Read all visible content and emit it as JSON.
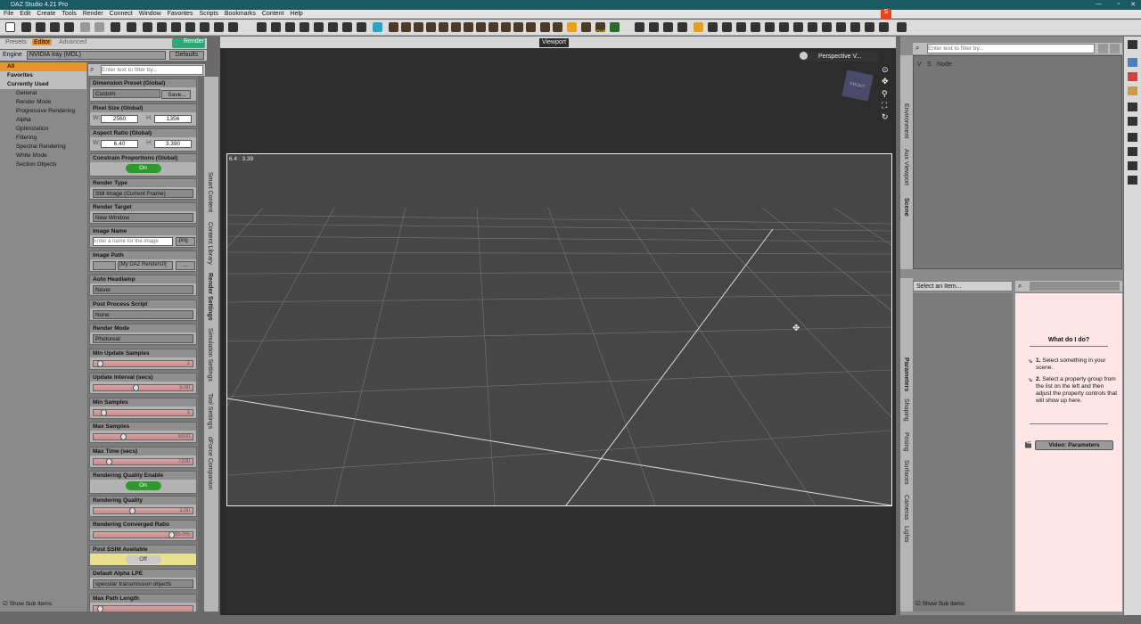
{
  "window": {
    "title": "DAZ Studio 4.21 Pro"
  },
  "menu": [
    "File",
    "Edit",
    "Create",
    "Tools",
    "Render",
    "Connect",
    "Window",
    "Favorites",
    "Scripts",
    "Bookmarks",
    "Content",
    "Help"
  ],
  "tabs": {
    "presets": "Presets",
    "editor": "Editor",
    "advanced": "Advanced",
    "render_btn": "Render"
  },
  "engine": {
    "label": "Engine",
    "value": "NVIDIA Iray (MDL)",
    "defaults": "Defaults"
  },
  "filter_placeholder": "Enter text to filter by...",
  "sections": [
    "All",
    "Favorites",
    "Currently Used",
    "General",
    "Render Mode",
    "Progressive Rendering",
    "Alpha",
    "Optimization",
    "Filtering",
    "Spectral Rendering",
    "White Mode",
    "Section Objects"
  ],
  "props": {
    "dim_preset": {
      "label": "Dimension Preset (Global)",
      "value": "Custom",
      "save": "Save..."
    },
    "pixel_size": {
      "label": "Pixel Size (Global)",
      "w": "2560",
      "h": "1356"
    },
    "aspect": {
      "label": "Aspect Ratio (Global)",
      "w": "6.40",
      "h": "3.390"
    },
    "constrain": {
      "label": "Constrain Proportions (Global)",
      "value": "On"
    },
    "render_type": {
      "label": "Render Type",
      "value": "Still Image (Current Frame)"
    },
    "render_target": {
      "label": "Render Target",
      "value": "New Window"
    },
    "image_name": {
      "label": "Image Name",
      "placeholder": "Enter a name for the image",
      "ext": ".png"
    },
    "image_path": {
      "label": "Image Path",
      "value": "[My DAZ Renders0]"
    },
    "auto_headlamp": {
      "label": "Auto Headlamp",
      "value": "Never"
    },
    "post_script": {
      "label": "Post Process Script",
      "value": "None"
    },
    "render_mode": {
      "label": "Render Mode",
      "value": "Photoreal"
    },
    "min_update": {
      "label": "Min Update Samples",
      "value": "1"
    },
    "update_interval": {
      "label": "Update Interval (secs)",
      "value": "5.00"
    },
    "min_samples": {
      "label": "Min Samples",
      "value": "1"
    },
    "max_samples": {
      "label": "Max Samples",
      "value": "5000"
    },
    "max_time": {
      "label": "Max Time (secs)",
      "value": "7200"
    },
    "quality_enable": {
      "label": "Rendering Quality Enable",
      "value": "On"
    },
    "quality": {
      "label": "Rendering Quality",
      "value": "1.00"
    },
    "converged": {
      "label": "Rendering Converged Ratio",
      "value": "95.0%"
    },
    "ssim": {
      "label": "Post SSIM Available",
      "value": "Off"
    },
    "alpha_lpe": {
      "label": "Default Alpha LPE",
      "value": "specular transmission objects"
    },
    "max_path": {
      "label": "Max Path Length"
    }
  },
  "left_vtabs": [
    "Smart Content",
    "Content Library",
    "Render Settings",
    "Simulation Settings",
    "Tool Settings",
    "dForce Companion"
  ],
  "show_sub": "Show Sub Items",
  "viewport": {
    "title": "Viewport",
    "camera": "Perspective V...",
    "aspect_text": "6.4 : 3.39",
    "cube": "FRONT"
  },
  "scene": {
    "filter_placeholder": "Enter text to filter by...",
    "col_v": "V",
    "col_s": "S",
    "col_node": "Node",
    "vtabs": [
      "Environment",
      "Aux Viewport",
      "Scene"
    ]
  },
  "params": {
    "select": "Select an Item...",
    "vtabs": [
      "Parameters",
      "Shaping",
      "Posing",
      "Surfaces",
      "Cameras",
      "Lights"
    ],
    "help_title": "What do I do?",
    "step1_num": "1.",
    "step1": "Select something in your scene.",
    "step2_num": "2.",
    "step2": "Select a property group from the list on the left and then adjust the property controls that will show up here.",
    "video": "Video: Parameters"
  },
  "tray": {
    "plus": "PLUS"
  }
}
